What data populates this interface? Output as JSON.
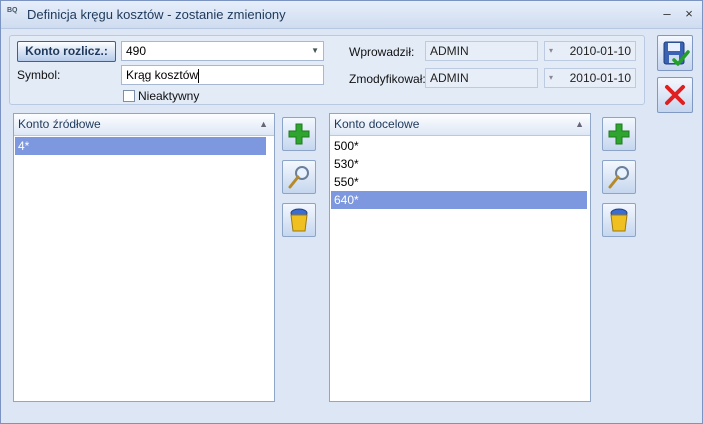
{
  "window": {
    "title": "Definicja kręgu kosztów - zostanie zmieniony",
    "icon_text": "BQ"
  },
  "titlebar": {
    "minimize": "–",
    "close": "×"
  },
  "form": {
    "konto_button": "Konto rozlicz.:",
    "konto_value": "490",
    "symbol_label": "Symbol:",
    "symbol_value": "Krąg kosztów",
    "nieaktywny_label": "Nieaktywny",
    "wprowadzil_label": "Wprowadził:",
    "wprowadzil_user": "ADMIN",
    "wprowadzil_date": "2010-01-10",
    "zmodyfikowal_label": "Zmodyfikował:",
    "zmodyfikowal_user": "ADMIN",
    "zmodyfikowal_date": "2010-01-10"
  },
  "source_list": {
    "header": "Konto źródłowe",
    "rows": [
      "4*"
    ]
  },
  "target_list": {
    "header": "Konto docelowe",
    "rows": [
      "500*",
      "530*",
      "550*",
      "640*"
    ]
  },
  "colors": {
    "selected_row": "#7d98df",
    "add_icon": "#2fa52f",
    "cancel_icon": "#e02020"
  }
}
